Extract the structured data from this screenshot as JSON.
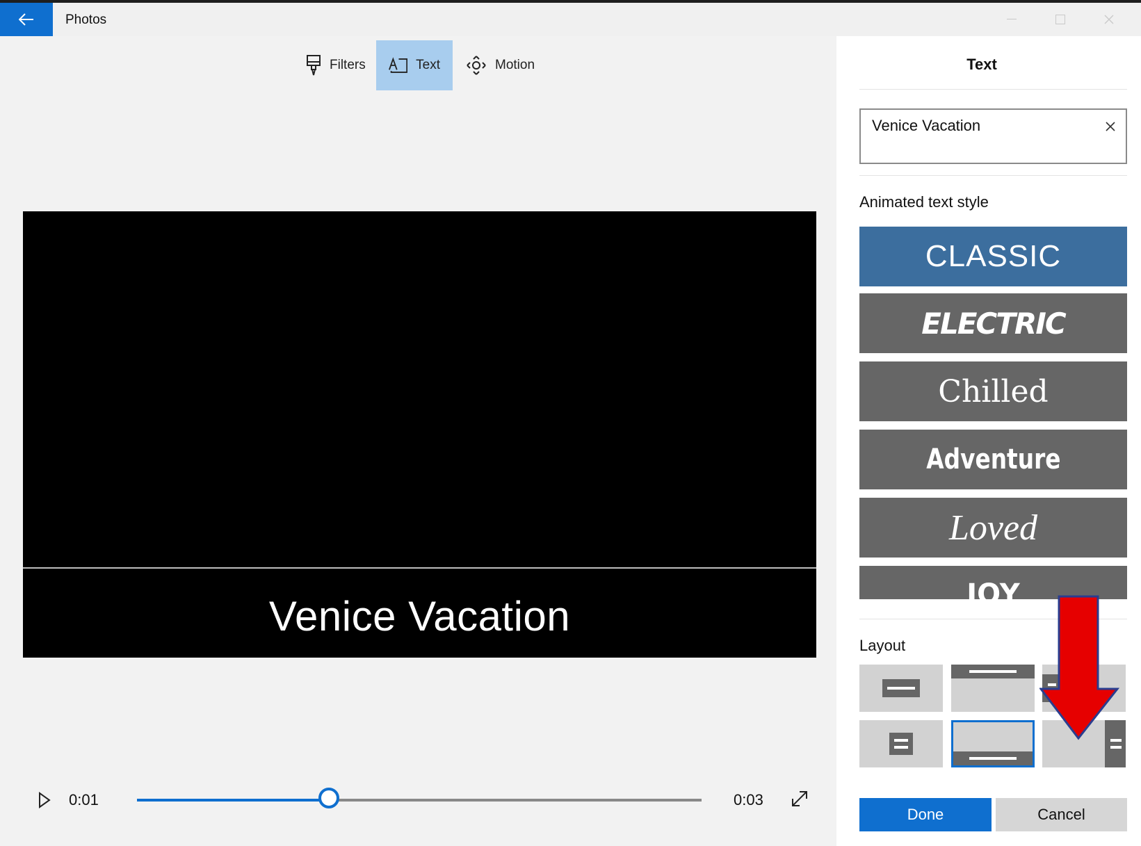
{
  "titlebar": {
    "title": "Photos",
    "back_icon": "back-arrow-icon"
  },
  "toolbar": {
    "items": [
      {
        "label": "Filters",
        "icon": "filters-brush-icon",
        "active": false
      },
      {
        "label": "Text",
        "icon": "text-icon",
        "active": true
      },
      {
        "label": "Motion",
        "icon": "motion-icon",
        "active": false
      }
    ]
  },
  "preview": {
    "caption": "Venice Vacation"
  },
  "playback": {
    "current_time": "0:01",
    "total_time": "0:03",
    "progress": 0.34
  },
  "panel": {
    "title": "Text",
    "text_input_value": "Venice Vacation",
    "animated_style_label": "Animated text style",
    "styles": [
      {
        "label": "CLASSIC",
        "selected": true
      },
      {
        "label": "ELECTRIC",
        "selected": false
      },
      {
        "label": "Chilled",
        "selected": false
      },
      {
        "label": "Adventure",
        "selected": false
      },
      {
        "label": "Loved",
        "selected": false
      },
      {
        "label": "JOY",
        "selected": false
      }
    ],
    "layout_label": "Layout",
    "done_label": "Done",
    "cancel_label": "Cancel"
  },
  "colors": {
    "accent": "#0f6fcf",
    "selected_style": "#3c6e9e",
    "style_tile": "#666666",
    "annotation_arrow": "#e60000"
  }
}
